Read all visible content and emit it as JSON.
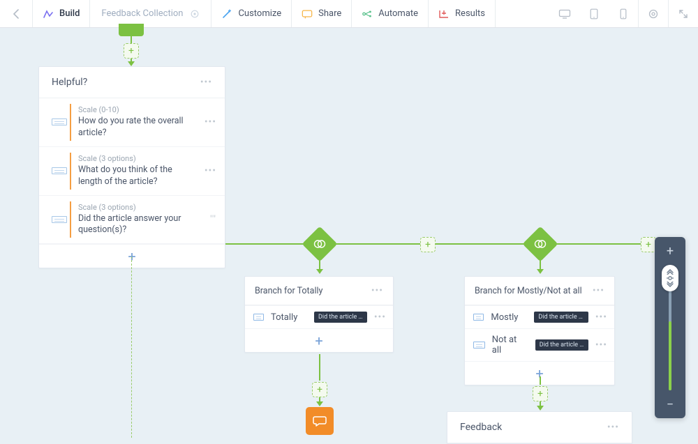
{
  "toolbar": {
    "build": "Build",
    "form_name": "Feedback Collection",
    "customize": "Customize",
    "share": "Share",
    "automate": "Automate",
    "results": "Results"
  },
  "colors": {
    "build": "#7a6ff0",
    "customize": "#4aa3f0",
    "share": "#f6b547",
    "automate": "#57c08a",
    "results": "#e05a5a",
    "accent_green": "#7cc142",
    "accent_orange": "#f28c28"
  },
  "cards": {
    "helpful": {
      "title": "Helpful?",
      "questions": [
        {
          "meta": "Scale (0-10)",
          "text": "How do you rate the overall article?"
        },
        {
          "meta": "Scale (3 options)",
          "text": "What do you think of the length of the article?"
        },
        {
          "meta": "Scale (3 options)",
          "text": "Did the article answer your question(s)?"
        }
      ]
    },
    "branch_totally": {
      "title": "Branch for Totally",
      "rows": [
        {
          "label": "Totally",
          "chip": "Did the article answer yo"
        }
      ]
    },
    "branch_mostly": {
      "title": "Branch for Mostly/Not at all",
      "rows": [
        {
          "label": "Mostly",
          "chip": "Did the article answer yo"
        },
        {
          "label": "Not at all",
          "chip": "Did the article answer"
        }
      ]
    },
    "feedback": {
      "title": "Feedback"
    }
  }
}
